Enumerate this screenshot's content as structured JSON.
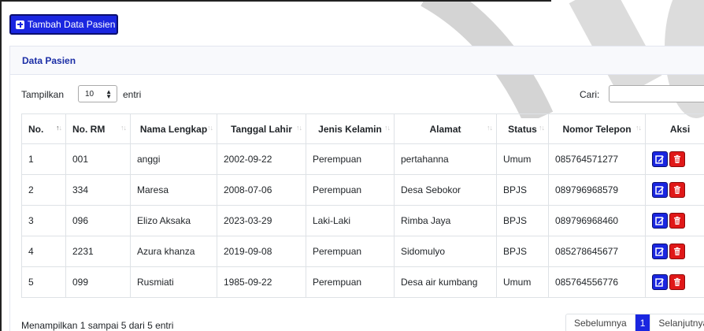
{
  "toolbar": {
    "add_label": "Tambah Data Pasien"
  },
  "card": {
    "title": "Data Pasien"
  },
  "controls": {
    "show_label": "Tampilkan",
    "page_size": "10",
    "entries_label": "entri",
    "search_label": "Cari:",
    "search_value": ""
  },
  "table": {
    "headers": [
      "No.",
      "No. RM",
      "Nama Lengkap",
      "Tanggal Lahir",
      "Jenis Kelamin",
      "Alamat",
      "Status",
      "Nomor Telepon",
      "Aksi"
    ],
    "rows": [
      {
        "no": "1",
        "rm": "001",
        "nama": "anggi",
        "tgl": "2002-09-22",
        "jk": "Perempuan",
        "alamat": "pertahanna",
        "status": "Umum",
        "telp": "085764571277"
      },
      {
        "no": "2",
        "rm": "334",
        "nama": "Maresa",
        "tgl": "2008-07-06",
        "jk": "Perempuan",
        "alamat": "Desa Sebokor",
        "status": "BPJS",
        "telp": "089796968579"
      },
      {
        "no": "3",
        "rm": "096",
        "nama": "Elizo Aksaka",
        "tgl": "2023-03-29",
        "jk": "Laki-Laki",
        "alamat": "Rimba Jaya",
        "status": "BPJS",
        "telp": "089796968460"
      },
      {
        "no": "4",
        "rm": "2231",
        "nama": "Azura khanza",
        "tgl": "2019-09-08",
        "jk": "Perempuan",
        "alamat": "Sidomulyo",
        "status": "BPJS",
        "telp": "085278645677"
      },
      {
        "no": "5",
        "rm": "099",
        "nama": "Rusmiati",
        "tgl": "1985-09-22",
        "jk": "Perempuan",
        "alamat": "Desa air kumbang",
        "status": "Umum",
        "telp": "085764556776"
      }
    ]
  },
  "footer": {
    "info": "Menampilkan 1 sampai 5 dari 5 entri",
    "prev": "Sebelumnya",
    "current_page": "1",
    "next": "Selanjutnya"
  },
  "colors": {
    "primary": "#1a26e0",
    "danger": "#e01818",
    "title": "#1b2ea6"
  },
  "icons": {
    "add": "plus-square-icon",
    "edit": "edit-icon",
    "delete": "trash-icon",
    "sort": "sort-arrows-icon"
  }
}
